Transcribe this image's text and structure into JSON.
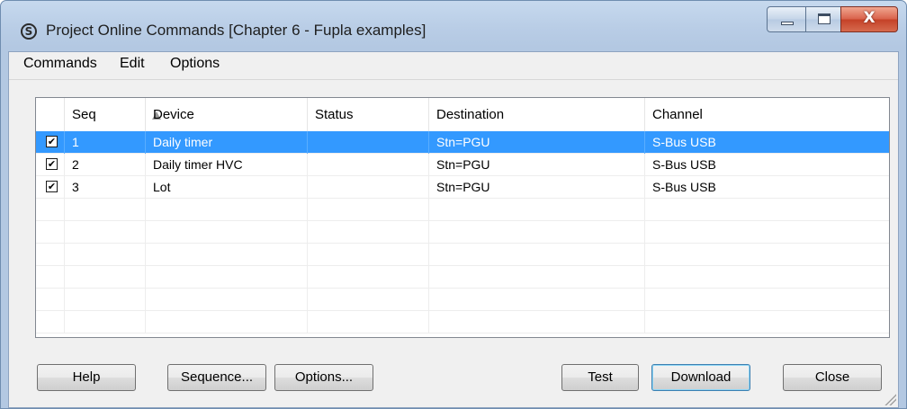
{
  "window": {
    "title": "Project Online Commands [Chapter 6 - Fupla examples]",
    "app_icon_glyph": "S",
    "controls": {
      "minimize": "minimize",
      "maximize": "maximize",
      "close_glyph": "X"
    }
  },
  "menubar": {
    "items": [
      "Commands",
      "Edit",
      "Options"
    ]
  },
  "table": {
    "columns": [
      "Seq",
      "Device",
      "Status",
      "Destination",
      "Channel"
    ],
    "sort": {
      "column": "Seq",
      "direction": "ascending"
    },
    "rows": [
      {
        "checked": true,
        "seq": "1",
        "device": "Daily timer",
        "status": "",
        "destination": "Stn=PGU",
        "channel": "S-Bus USB",
        "selected": true
      },
      {
        "checked": true,
        "seq": "2",
        "device": "Daily timer HVC",
        "status": "",
        "destination": "Stn=PGU",
        "channel": "S-Bus USB",
        "selected": false
      },
      {
        "checked": true,
        "seq": "3",
        "device": "Lot",
        "status": "",
        "destination": "Stn=PGU",
        "channel": "S-Bus USB",
        "selected": false
      }
    ]
  },
  "buttons": {
    "help": "Help",
    "sequence": "Sequence...",
    "options": "Options...",
    "test": "Test",
    "download": "Download",
    "close": "Close"
  },
  "colors": {
    "selection": "#3399ff",
    "titlebar": "#b9cde6",
    "close_button": "#c44127"
  }
}
